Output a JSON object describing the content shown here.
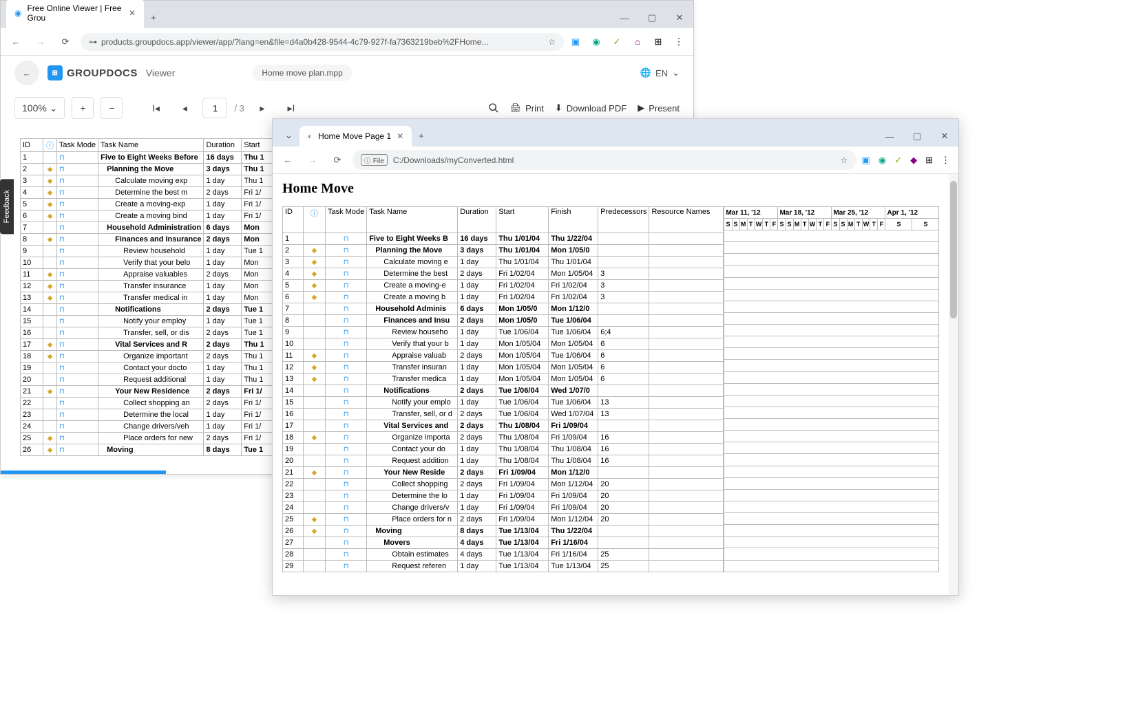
{
  "win1": {
    "tab_title": "Free Online Viewer | Free Grou",
    "url": "products.groupdocs.app/viewer/app/?lang=en&file=d4a0b428-9544-4c79-927f-fa7363219beb%2FHome...",
    "min": "—",
    "max": "▢",
    "close": "✕"
  },
  "app": {
    "brand": "GROUPDOCS",
    "product": "Viewer",
    "filename": "Home move plan.mpp",
    "lang": "EN",
    "zoom": "100%",
    "page": "1",
    "pages": "/ 3",
    "print": "Print",
    "download": "Download PDF",
    "present": "Present",
    "feedback": "Feedback"
  },
  "t1_headers": {
    "id": "ID",
    "mode": "Task Mode",
    "name": "Task Name",
    "dur": "Duration",
    "start": "Start"
  },
  "t1_rows": [
    {
      "id": "1",
      "note": false,
      "name": "Five to Eight Weeks Before",
      "dur": "16 days",
      "start": "Thu 1",
      "bold": true,
      "ind": 0
    },
    {
      "id": "2",
      "note": true,
      "name": "Planning the Move",
      "dur": "3 days",
      "start": "Thu 1",
      "bold": true,
      "ind": 1
    },
    {
      "id": "3",
      "note": true,
      "name": "Calculate moving exp",
      "dur": "1 day",
      "start": "Thu 1",
      "ind": 2
    },
    {
      "id": "4",
      "note": true,
      "name": "Determine the best m",
      "dur": "2 days",
      "start": "Fri 1/",
      "ind": 2
    },
    {
      "id": "5",
      "note": true,
      "name": "Create a moving-exp",
      "dur": "1 day",
      "start": "Fri 1/",
      "ind": 2
    },
    {
      "id": "6",
      "note": true,
      "name": "Create a moving bind",
      "dur": "1 day",
      "start": "Fri 1/",
      "ind": 2
    },
    {
      "id": "7",
      "note": false,
      "name": "Household Administration",
      "dur": "6 days",
      "start": "Mon",
      "bold": true,
      "ind": 1
    },
    {
      "id": "8",
      "note": true,
      "name": "Finances and Insurance",
      "dur": "2 days",
      "start": "Mon",
      "bold": true,
      "ind": 2
    },
    {
      "id": "9",
      "note": false,
      "name": "Review household",
      "dur": "1 day",
      "start": "Tue 1",
      "ind": 3
    },
    {
      "id": "10",
      "note": false,
      "name": "Verify that your belo",
      "dur": "1 day",
      "start": "Mon",
      "ind": 3
    },
    {
      "id": "11",
      "note": true,
      "name": "Appraise valuables",
      "dur": "2 days",
      "start": "Mon",
      "ind": 3
    },
    {
      "id": "12",
      "note": true,
      "name": "Transfer insurance",
      "dur": "1 day",
      "start": "Mon",
      "ind": 3
    },
    {
      "id": "13",
      "note": true,
      "name": "Transfer medical in",
      "dur": "1 day",
      "start": "Mon",
      "ind": 3
    },
    {
      "id": "14",
      "note": false,
      "name": "Notifications",
      "dur": "2 days",
      "start": "Tue 1",
      "bold": true,
      "ind": 2
    },
    {
      "id": "15",
      "note": false,
      "name": "Notify your employ",
      "dur": "1 day",
      "start": "Tue 1",
      "ind": 3
    },
    {
      "id": "16",
      "note": false,
      "name": "Transfer, sell, or dis",
      "dur": "2 days",
      "start": "Tue 1",
      "ind": 3
    },
    {
      "id": "17",
      "note": true,
      "name": "Vital Services and R",
      "dur": "2 days",
      "start": "Thu 1",
      "bold": true,
      "ind": 2
    },
    {
      "id": "18",
      "note": true,
      "name": "Organize important",
      "dur": "2 days",
      "start": "Thu 1",
      "ind": 3
    },
    {
      "id": "19",
      "note": false,
      "name": "Contact your docto",
      "dur": "1 day",
      "start": "Thu 1",
      "ind": 3
    },
    {
      "id": "20",
      "note": false,
      "name": "Request additional",
      "dur": "1 day",
      "start": "Thu 1",
      "ind": 3
    },
    {
      "id": "21",
      "note": true,
      "name": "Your New Residence",
      "dur": "2 days",
      "start": "Fri 1/",
      "bold": true,
      "ind": 2
    },
    {
      "id": "22",
      "note": false,
      "name": "Collect shopping an",
      "dur": "2 days",
      "start": "Fri 1/",
      "ind": 3
    },
    {
      "id": "23",
      "note": false,
      "name": "Determine the local",
      "dur": "1 day",
      "start": "Fri 1/",
      "ind": 3
    },
    {
      "id": "24",
      "note": false,
      "name": "Change drivers/veh",
      "dur": "1 day",
      "start": "Fri 1/",
      "ind": 3
    },
    {
      "id": "25",
      "note": true,
      "name": "Place orders for new",
      "dur": "2 days",
      "start": "Fri 1/",
      "ind": 3
    },
    {
      "id": "26",
      "note": true,
      "name": "Moving",
      "dur": "8 days",
      "start": "Tue 1",
      "bold": true,
      "ind": 1
    }
  ],
  "win2": {
    "tab_title": "Home Move Page 1",
    "file_label": "File",
    "url": "C:/Downloads/myConverted.html",
    "page_title": "Home Move",
    "min": "—",
    "max": "▢",
    "close": "✕"
  },
  "t2_headers": {
    "id": "ID",
    "mode": "Task Mode",
    "name": "Task Name",
    "dur": "Duration",
    "start": "Start",
    "finish": "Finish",
    "pred": "Predecessors",
    "res": "Resource Names"
  },
  "gantt_weeks": [
    "Mar 11, '12",
    "Mar 18, '12",
    "Mar 25, '12",
    "Apr 1, '12"
  ],
  "gantt_days": [
    "S",
    "S",
    "M",
    "T",
    "W",
    "T",
    "F",
    "S",
    "S",
    "M",
    "T",
    "W",
    "T",
    "F",
    "S",
    "S",
    "M",
    "T",
    "W",
    "T",
    "F",
    "S",
    "S"
  ],
  "t2_rows": [
    {
      "id": "1",
      "note": false,
      "name": "Five to Eight Weeks B",
      "dur": "16 days",
      "start": "Thu 1/01/04",
      "finish": "Thu 1/22/04",
      "pred": "",
      "bold": true,
      "ind": 0
    },
    {
      "id": "2",
      "note": true,
      "name": "Planning the Move",
      "dur": "3 days",
      "start": "Thu 1/01/04",
      "finish": "Mon 1/05/0",
      "pred": "",
      "bold": true,
      "ind": 1
    },
    {
      "id": "3",
      "note": true,
      "name": "Calculate moving e",
      "dur": "1 day",
      "start": "Thu 1/01/04",
      "finish": "Thu 1/01/04",
      "pred": "",
      "ind": 2
    },
    {
      "id": "4",
      "note": true,
      "name": "Determine the best",
      "dur": "2 days",
      "start": "Fri 1/02/04",
      "finish": "Mon 1/05/04",
      "pred": "3",
      "ind": 2
    },
    {
      "id": "5",
      "note": true,
      "name": "Create a moving-e",
      "dur": "1 day",
      "start": "Fri 1/02/04",
      "finish": "Fri 1/02/04",
      "pred": "3",
      "ind": 2
    },
    {
      "id": "6",
      "note": true,
      "name": "Create a moving b",
      "dur": "1 day",
      "start": "Fri 1/02/04",
      "finish": "Fri 1/02/04",
      "pred": "3",
      "ind": 2
    },
    {
      "id": "7",
      "note": false,
      "name": "Household Adminis",
      "dur": "6 days",
      "start": "Mon 1/05/0",
      "finish": "Mon 1/12/0",
      "pred": "",
      "bold": true,
      "ind": 1
    },
    {
      "id": "8",
      "note": false,
      "name": "Finances and Insu",
      "dur": "2 days",
      "start": "Mon 1/05/0",
      "finish": "Tue 1/06/04",
      "pred": "",
      "bold": true,
      "ind": 2
    },
    {
      "id": "9",
      "note": false,
      "name": "Review househo",
      "dur": "1 day",
      "start": "Tue 1/06/04",
      "finish": "Tue 1/06/04",
      "pred": "6;4",
      "ind": 3
    },
    {
      "id": "10",
      "note": false,
      "name": "Verify that your b",
      "dur": "1 day",
      "start": "Mon 1/05/04",
      "finish": "Mon 1/05/04",
      "pred": "6",
      "ind": 3
    },
    {
      "id": "11",
      "note": true,
      "name": "Appraise valuab",
      "dur": "2 days",
      "start": "Mon 1/05/04",
      "finish": "Tue 1/06/04",
      "pred": "6",
      "ind": 3
    },
    {
      "id": "12",
      "note": true,
      "name": "Transfer insuran",
      "dur": "1 day",
      "start": "Mon 1/05/04",
      "finish": "Mon 1/05/04",
      "pred": "6",
      "ind": 3
    },
    {
      "id": "13",
      "note": true,
      "name": "Transfer medica",
      "dur": "1 day",
      "start": "Mon 1/05/04",
      "finish": "Mon 1/05/04",
      "pred": "6",
      "ind": 3
    },
    {
      "id": "14",
      "note": false,
      "name": "Notifications",
      "dur": "2 days",
      "start": "Tue 1/06/04",
      "finish": "Wed 1/07/0",
      "pred": "",
      "bold": true,
      "ind": 2
    },
    {
      "id": "15",
      "note": false,
      "name": "Notify your emplo",
      "dur": "1 day",
      "start": "Tue 1/06/04",
      "finish": "Tue 1/06/04",
      "pred": "13",
      "ind": 3
    },
    {
      "id": "16",
      "note": false,
      "name": "Transfer, sell, or d",
      "dur": "2 days",
      "start": "Tue 1/06/04",
      "finish": "Wed 1/07/04",
      "pred": "13",
      "ind": 3
    },
    {
      "id": "17",
      "note": false,
      "name": "Vital Services and",
      "dur": "2 days",
      "start": "Thu 1/08/04",
      "finish": "Fri 1/09/04",
      "pred": "",
      "bold": true,
      "ind": 2
    },
    {
      "id": "18",
      "note": true,
      "name": "Organize importa",
      "dur": "2 days",
      "start": "Thu 1/08/04",
      "finish": "Fri 1/09/04",
      "pred": "16",
      "ind": 3
    },
    {
      "id": "19",
      "note": false,
      "name": "Contact your do",
      "dur": "1 day",
      "start": "Thu 1/08/04",
      "finish": "Thu 1/08/04",
      "pred": "16",
      "ind": 3
    },
    {
      "id": "20",
      "note": false,
      "name": "Request addition",
      "dur": "1 day",
      "start": "Thu 1/08/04",
      "finish": "Thu 1/08/04",
      "pred": "16",
      "ind": 3
    },
    {
      "id": "21",
      "note": true,
      "name": "Your New Reside",
      "dur": "2 days",
      "start": "Fri 1/09/04",
      "finish": "Mon 1/12/0",
      "pred": "",
      "bold": true,
      "ind": 2
    },
    {
      "id": "22",
      "note": false,
      "name": "Collect shopping",
      "dur": "2 days",
      "start": "Fri 1/09/04",
      "finish": "Mon 1/12/04",
      "pred": "20",
      "ind": 3
    },
    {
      "id": "23",
      "note": false,
      "name": "Determine the lo",
      "dur": "1 day",
      "start": "Fri 1/09/04",
      "finish": "Fri 1/09/04",
      "pred": "20",
      "ind": 3
    },
    {
      "id": "24",
      "note": false,
      "name": "Change drivers/v",
      "dur": "1 day",
      "start": "Fri 1/09/04",
      "finish": "Fri 1/09/04",
      "pred": "20",
      "ind": 3
    },
    {
      "id": "25",
      "note": true,
      "name": "Place orders for n",
      "dur": "2 days",
      "start": "Fri 1/09/04",
      "finish": "Mon 1/12/04",
      "pred": "20",
      "ind": 3
    },
    {
      "id": "26",
      "note": true,
      "name": "Moving",
      "dur": "8 days",
      "start": "Tue 1/13/04",
      "finish": "Thu 1/22/04",
      "pred": "",
      "bold": true,
      "ind": 1
    },
    {
      "id": "27",
      "note": false,
      "name": "Movers",
      "dur": "4 days",
      "start": "Tue 1/13/04",
      "finish": "Fri 1/16/04",
      "pred": "",
      "bold": true,
      "ind": 2
    },
    {
      "id": "28",
      "note": false,
      "name": "Obtain estimates",
      "dur": "4 days",
      "start": "Tue 1/13/04",
      "finish": "Fri 1/16/04",
      "pred": "25",
      "ind": 3
    },
    {
      "id": "29",
      "note": false,
      "name": "Request referen",
      "dur": "1 day",
      "start": "Tue 1/13/04",
      "finish": "Tue 1/13/04",
      "pred": "25",
      "ind": 3
    }
  ]
}
